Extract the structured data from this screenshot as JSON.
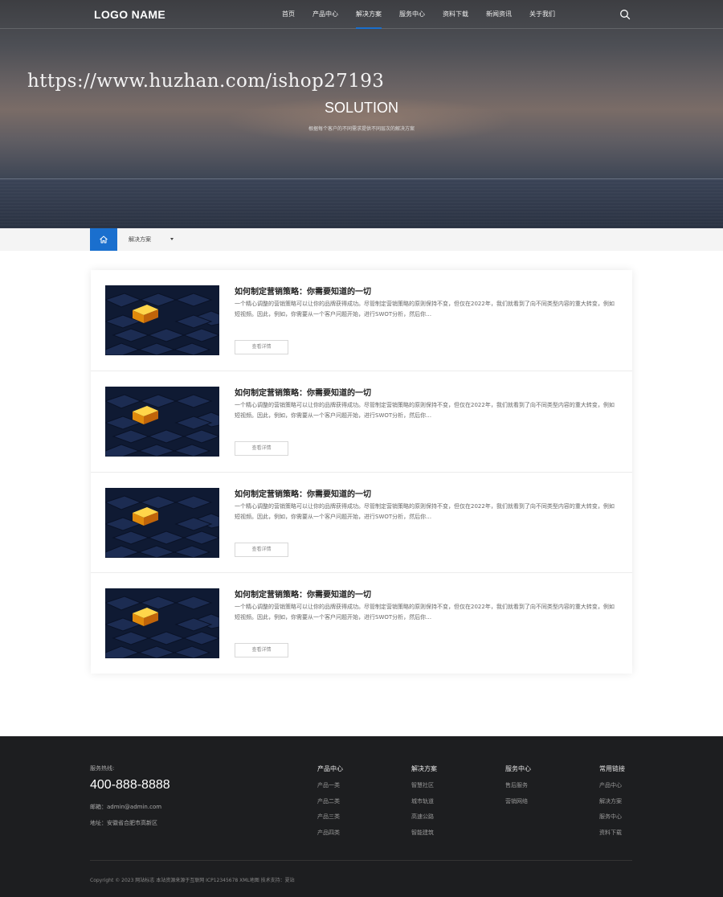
{
  "brand": {
    "logo": "LOGO NAME",
    "accent": "#1a6fce"
  },
  "nav": {
    "items": [
      {
        "label": "首页"
      },
      {
        "label": "产品中心"
      },
      {
        "label": "解决方案",
        "active": true
      },
      {
        "label": "服务中心"
      },
      {
        "label": "资料下载"
      },
      {
        "label": "新闻资讯"
      },
      {
        "label": "关于我们"
      }
    ],
    "search_icon": "search-icon"
  },
  "hero": {
    "watermark": "https://www.huzhan.com/ishop27193",
    "title": "SOLUTION",
    "subtitle": "根据每个客户的不同需求提供不同层次的解决方案"
  },
  "breadcrumb": {
    "home_icon": "home-icon",
    "label": "解决方案"
  },
  "list": {
    "items": [
      {
        "title": "如何制定营销策略：你需要知道的一切",
        "desc": "一个精心调整的营销策略可以让你的品牌获得成功。尽管制定营销策略的原则保持不变，但仅在2022年，我们就看到了向不同类型内容的重大转变，例如短视频。因此，例如，你需要从一个客户问题开始，进行SWOT分析，然后你…",
        "button": "查看详情"
      },
      {
        "title": "如何制定营销策略：你需要知道的一切",
        "desc": "一个精心调整的营销策略可以让你的品牌获得成功。尽管制定营销策略的原则保持不变，但仅在2022年，我们就看到了向不同类型内容的重大转变，例如短视频。因此，例如，你需要从一个客户问题开始，进行SWOT分析，然后你…",
        "button": "查看详情"
      },
      {
        "title": "如何制定营销策略：你需要知道的一切",
        "desc": "一个精心调整的营销策略可以让你的品牌获得成功。尽管制定营销策略的原则保持不变，但仅在2022年，我们就看到了向不同类型内容的重大转变，例如短视频。因此，例如，你需要从一个客户问题开始，进行SWOT分析，然后你…",
        "button": "查看详情"
      },
      {
        "title": "如何制定营销策略：你需要知道的一切",
        "desc": "一个精心调整的营销策略可以让你的品牌获得成功。尽管制定营销策略的原则保持不变，但仅在2022年，我们就看到了向不同类型内容的重大转变，例如短视频。因此，例如，你需要从一个客户问题开始，进行SWOT分析，然后你…",
        "button": "查看详情"
      }
    ]
  },
  "footer": {
    "hotline_label": "服务热线:",
    "phone": "400-888-8888",
    "email": "邮箱：admin@admin.com",
    "address": "地址：安徽省合肥市高新区",
    "columns": [
      {
        "title": "产品中心",
        "links": [
          "产品一类",
          "产品二类",
          "产品三类",
          "产品四类"
        ]
      },
      {
        "title": "解决方案",
        "links": [
          "智慧社区",
          "城市轨道",
          "高速公路",
          "智能建筑"
        ]
      },
      {
        "title": "服务中心",
        "links": [
          "售后服务",
          "营销网络"
        ]
      },
      {
        "title": "常用链接",
        "links": [
          "产品中心",
          "解决方案",
          "服务中心",
          "资料下载"
        ]
      }
    ],
    "copyright": "Copyright © 2023 网站标志 本站资源来源于互联网 ICP12345678 XML地图 技术支持：夏站"
  }
}
